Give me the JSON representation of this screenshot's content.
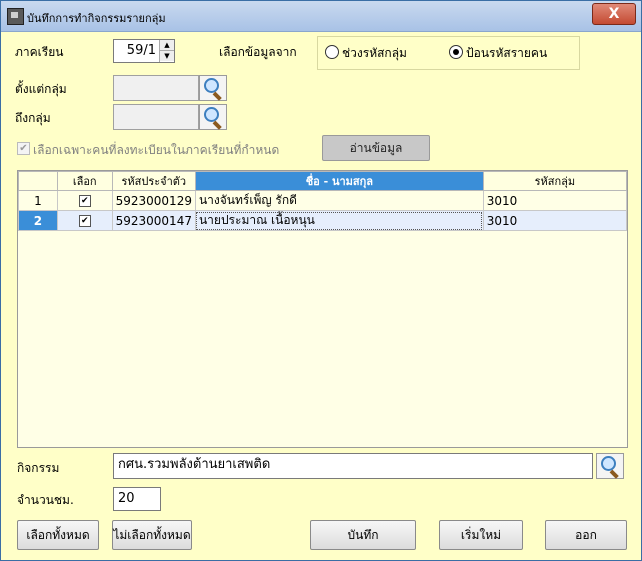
{
  "window": {
    "title": "บันทึกการทำกิจกรรมรายกลุ่ม",
    "close_glyph": "X"
  },
  "form": {
    "semester_label": "ภาคเรียน",
    "semester_value": "59/1",
    "select_from_label": "เลือกข้อมูลจาก",
    "radio_range_label": "ช่วงรหัสกลุ่ม",
    "radio_individual_label": "ป้อนรหัสรายคน",
    "from_group_label": "ตั้งแต่กลุ่ม",
    "to_group_label": "ถึงกลุ่ม",
    "registered_only_label": "เลือกเฉพาะคนที่ลงทะเบียนในภาคเรียนที่กำหนด",
    "read_button": "อ่านข้อมูล"
  },
  "table": {
    "headers": [
      "",
      "เลือก",
      "รหัสประจำตัว",
      "ชื่อ - นามสกุล",
      "รหัสกลุ่ม"
    ],
    "rows": [
      {
        "no": "1",
        "id": "5923000129",
        "name": "นางจันทร์เพ็ญ รักดี",
        "group": "3010"
      },
      {
        "no": "2",
        "id": "5923000147",
        "name": "นายประมาณ เนื้อหนุน",
        "group": "3010"
      }
    ]
  },
  "activity": {
    "label": "กิจกรรม",
    "value": "กศน.รวมพลังต้านยาเสพติด"
  },
  "hours": {
    "label": "จำนวนชม.",
    "value": "20"
  },
  "buttons": {
    "select_all": "เลือกทั้งหมด",
    "deselect_all": "ไม่เลือกทั้งหมด",
    "save": "บันทึก",
    "reset": "เริ่มใหม่",
    "exit": "ออก"
  }
}
